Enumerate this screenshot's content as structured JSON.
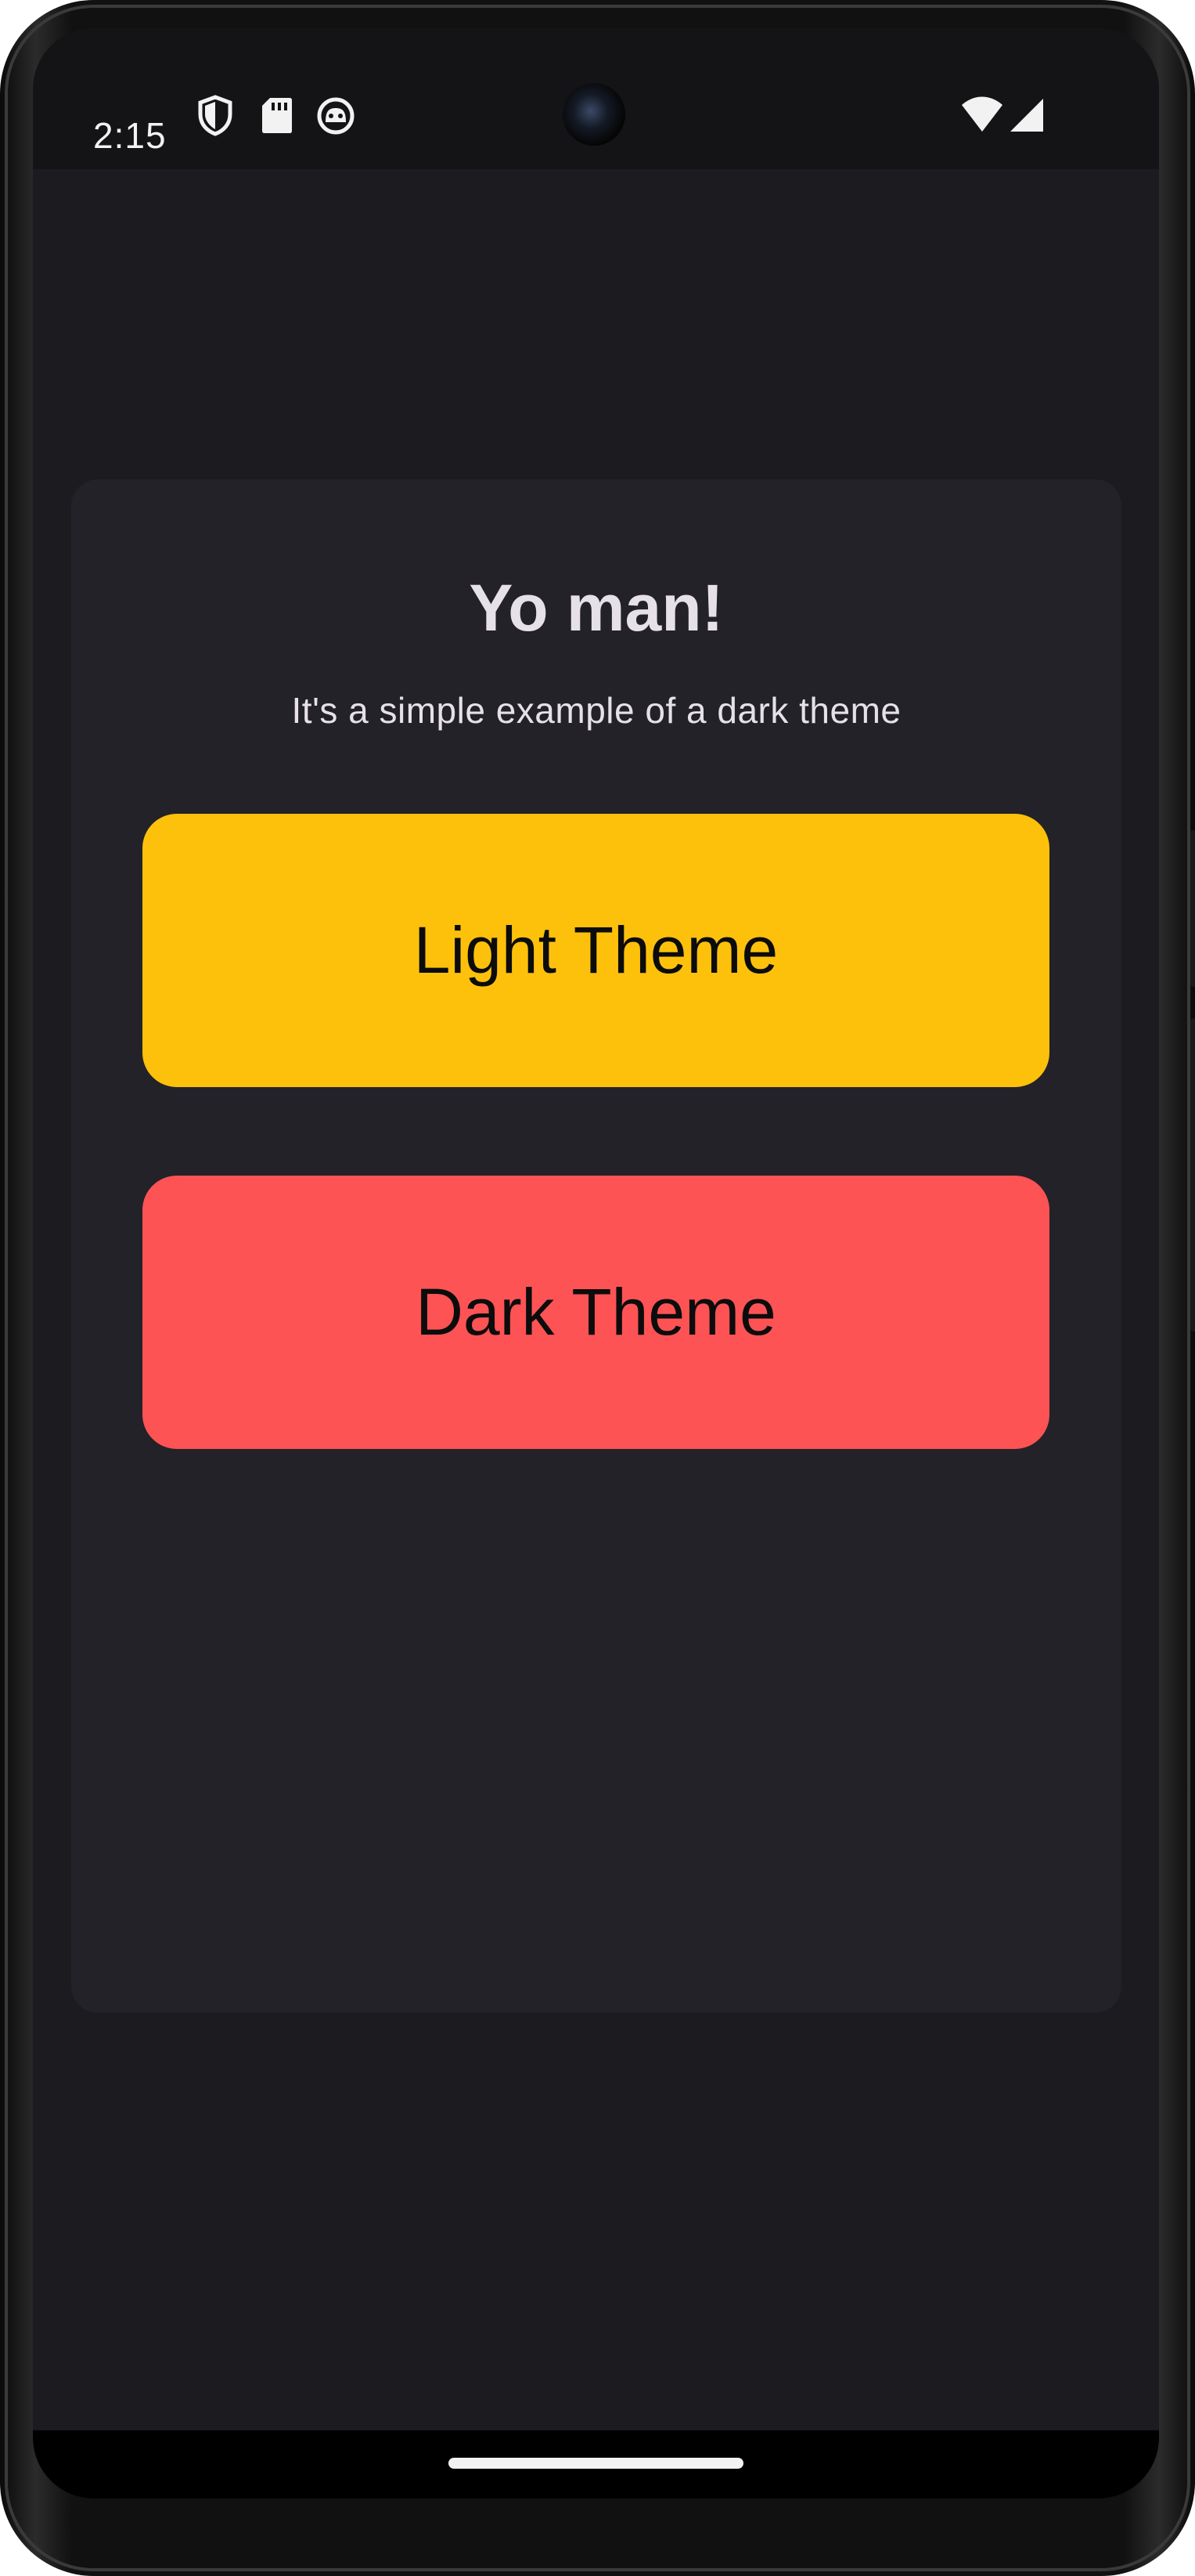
{
  "status_bar": {
    "time": "2:15",
    "icons": [
      "shield-icon",
      "sd-card-icon",
      "cat-face-icon",
      "wifi-icon",
      "cellular-signal-icon"
    ]
  },
  "card": {
    "title": "Yo man!",
    "subtitle": "It's a simple example of a dark theme"
  },
  "buttons": {
    "light_label": "Light Theme",
    "dark_label": "Dark Theme"
  },
  "colors": {
    "background": "#1c1b20",
    "card": "#232228",
    "light_button": "#fdc10c",
    "dark_button": "#fd5355",
    "text_primary": "#e6e1e8"
  }
}
